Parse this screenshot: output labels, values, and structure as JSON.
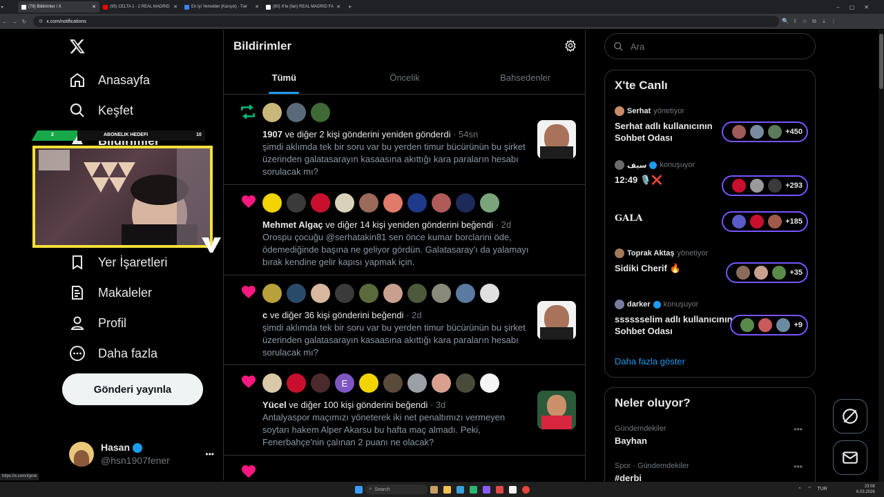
{
  "browser": {
    "tabs": [
      {
        "label": "(79) Bildirimler / X",
        "active": true,
        "fav_color": "#ffffff"
      },
      {
        "label": "(95) CELTA 1 - 2 REAL MADRID",
        "active": false,
        "fav_color": "#ff0000"
      },
      {
        "label": "En İyi Yemekler (Karışık) - Tier",
        "active": false,
        "fav_color": "#3b82f6"
      },
      {
        "label": "(80) X'te (fan) REAL MADRID FA",
        "active": false,
        "fav_color": "#ffffff"
      }
    ],
    "url": "x.com/notifications",
    "status_url": "https://x.com/i/grok"
  },
  "sidebar": {
    "logo": "X",
    "items": [
      {
        "label": "Anasayfa",
        "icon": "home-icon"
      },
      {
        "label": "Keşfet",
        "icon": "search-icon"
      },
      {
        "label": "Bildirimler",
        "icon": "bell-icon"
      },
      {
        "label": "Yer İşaretleri",
        "icon": "bookmark-icon"
      },
      {
        "label": "Makaleler",
        "icon": "article-icon"
      },
      {
        "label": "Profil",
        "icon": "profile-icon"
      },
      {
        "label": "Daha fazla",
        "icon": "more-circle-icon"
      }
    ],
    "post_button": "Gönderi yayınla",
    "user": {
      "name": "Hasan",
      "handle": "@hsn1907fener",
      "more": "•••"
    }
  },
  "overlay": {
    "left_badge": "2",
    "heading": "ABONELIK HEDEFI",
    "count": "10"
  },
  "main": {
    "title": "Bildirimler",
    "tabs": [
      "Tümü",
      "Öncelik",
      "Bahsedenler"
    ],
    "notifications": [
      {
        "type": "repost",
        "actor": "1907",
        "text": " ve diğer 2 kişi gönderini yeniden gönderdi",
        "time": " · 54sn",
        "body": "şimdi aklımda tek bir soru var bu yerden timur bücürünün bu şirket üzerinden galatasarayın kasaasına akıttığı kara paraların hesabı sorulacak mı?",
        "avatars": 3
      },
      {
        "type": "like",
        "actor": "Mehmet Algaç",
        "text": " ve diğer 14 kişi yeniden gönderini beğendi",
        "time": " · 2d",
        "body": "Orospu çocuğu @serhatakin81 sen önce kumar borclarini öde, ödemediğinde başına ne geliyor gördün. Galatasaray'ı da yalamayı bırak kendine gelir kapısı yapmak için.",
        "avatars": 10
      },
      {
        "type": "like",
        "actor": "c",
        "text": " ve diğer 36 kişi gönderini beğendi",
        "time": " · 2d",
        "body": "şimdi aklımda tek bir soru var bu yerden timur bücürünün bu şirket üzerinden galatasarayın kasaasına akıttığı kara paraların hesabı sorulacak mı?",
        "avatars": 10
      },
      {
        "type": "like",
        "actor": "Yücel",
        "text": " ve diğer 100 kişi gönderini beğendi",
        "time": " · 3d",
        "body": "Antalyaspor maçımızı yöneterek iki net penaltımızı vermeyen soytarı hakem Alper Akarsu bu hafta maç almadı. Peki, Fenerbahçe'nin çalınan 2 puanı ne olacak?",
        "avatars": 10
      }
    ]
  },
  "right": {
    "search_placeholder": "Ara",
    "live": {
      "title": "X'te Canlı",
      "items": [
        {
          "host": "Serhat",
          "role": " yönetiyor",
          "title": "Serhat adlı kullanıcının Sohbet Odası",
          "count": "+450"
        },
        {
          "host": "سيف",
          "role": " konuşuyor",
          "title": "12:49 🎙️❌",
          "count": "+293"
        },
        {
          "host": "",
          "role": "",
          "title": "GALA",
          "count": "+185"
        },
        {
          "host": "Toprak Aktaş",
          "role": " yönetiyor",
          "title": "Sidiki Cherif 🔥",
          "count": "+35"
        },
        {
          "host": "darker",
          "role": " konuşuyor",
          "title": "sssssselim adlı kullanıcının Sohbet Odası",
          "count": "+9"
        }
      ],
      "more": "Daha fazla göster"
    },
    "trends": {
      "title": "Neler oluyor?",
      "items": [
        {
          "meta": "Gündemdekiler",
          "name": "Bayhan"
        },
        {
          "meta": "Spor · Gündemdekiler",
          "name": "#derbi"
        }
      ]
    }
  },
  "taskbar": {
    "search": "Search",
    "lang": "TUR",
    "time": "23:08",
    "date": "6.03.2026"
  }
}
